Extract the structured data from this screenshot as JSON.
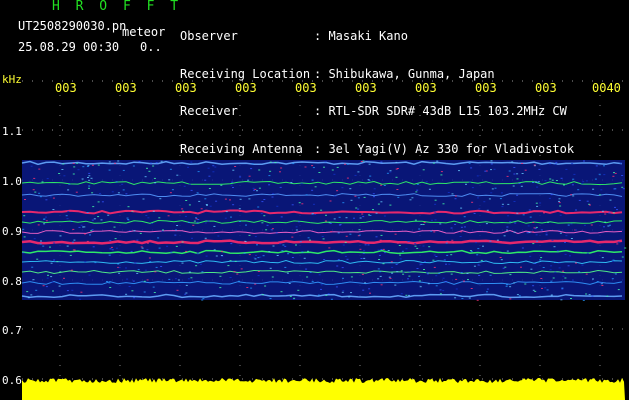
{
  "header": {
    "title": "H R O F F T",
    "filename": "UT2508290030.pn",
    "meteor_label": "meteor",
    "datetime": "25.08.29 00:30",
    "flag": "0.."
  },
  "info": [
    {
      "key": "Observer",
      "value": ": Masaki Kano"
    },
    {
      "key": "Receiving Location",
      "value": ": Shibukawa, Gunma, Japan"
    },
    {
      "key": "Receiver",
      "value": ": RTL-SDR SDR# 43dB L15 103.2MHz CW"
    },
    {
      "key": "Receiving Antenna",
      "value": ": 3el Yagi(V) Az 330 for Vladivostok"
    }
  ],
  "axis": {
    "y_unit": "kHz",
    "x_ticks": [
      "003",
      "003",
      "003",
      "003",
      "003",
      "003",
      "003",
      "003",
      "003",
      "0040"
    ],
    "y_ticks": [
      "1.1",
      "1.0",
      "0.9",
      "0.8",
      "0.7",
      "0.6"
    ]
  },
  "colors": {
    "background": "#000000",
    "noise_base": "#0a1a8c",
    "echo": "#ff2a6a",
    "echo_secondary": "#33ff66",
    "power_bar": "#ffff00",
    "grid": "#ffffff"
  }
}
